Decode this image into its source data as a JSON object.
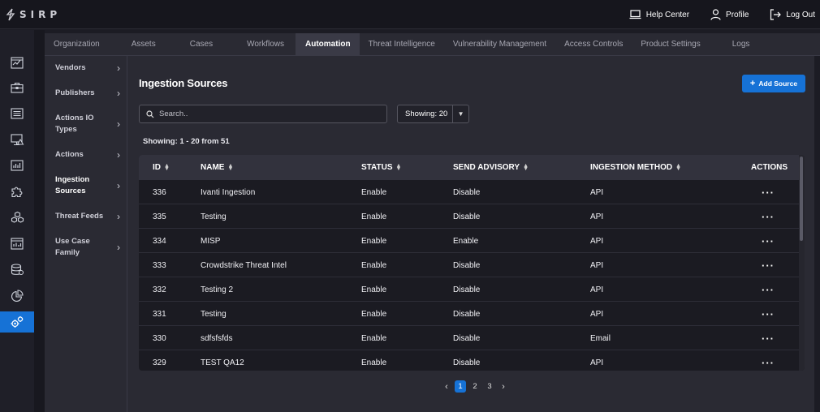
{
  "app": {
    "logo_text": "SIRP"
  },
  "topbar": {
    "help_center": "Help Center",
    "profile": "Profile",
    "logout": "Log Out"
  },
  "rail": {
    "items": [
      "dashboard-icon",
      "briefcase-icon",
      "list-icon",
      "monitor-alert-icon",
      "chart-icon",
      "puzzle-icon",
      "cubes-icon",
      "report-icon",
      "database-icon",
      "pie-chart-icon",
      "gears-icon"
    ],
    "active_index": 10
  },
  "tabs": [
    {
      "label": "Organization"
    },
    {
      "label": "Assets"
    },
    {
      "label": "Cases"
    },
    {
      "label": "Workflows"
    },
    {
      "label": "Automation",
      "active": true
    },
    {
      "label": "Threat Intelligence"
    },
    {
      "label": "Vulnerability Management"
    },
    {
      "label": "Access Controls"
    },
    {
      "label": "Product Settings"
    },
    {
      "label": "Logs"
    }
  ],
  "subnav": [
    {
      "label": "Vendors"
    },
    {
      "label": "Publishers"
    },
    {
      "label": "Actions IO Types"
    },
    {
      "label": "Actions"
    },
    {
      "label": "Ingestion Sources",
      "active": true
    },
    {
      "label": "Threat Feeds"
    },
    {
      "label": "Use Case Family"
    }
  ],
  "main": {
    "title": "Ingestion Sources",
    "add_button": "Add Source",
    "search_placeholder": "Search..",
    "showing_select": "Showing: 20",
    "count_text": "Showing: 1 - 20 from 51"
  },
  "table": {
    "columns": [
      "ID",
      "NAME",
      "STATUS",
      "SEND ADVISORY",
      "INGESTION METHOD",
      "ACTIONS"
    ],
    "rows": [
      {
        "id": "336",
        "name": "Ivanti Ingestion",
        "status": "Enable",
        "advisory": "Disable",
        "method": "API"
      },
      {
        "id": "335",
        "name": "Testing",
        "status": "Enable",
        "advisory": "Disable",
        "method": "API"
      },
      {
        "id": "334",
        "name": "MISP",
        "status": "Enable",
        "advisory": "Enable",
        "method": "API"
      },
      {
        "id": "333",
        "name": "Crowdstrike Threat Intel",
        "status": "Enable",
        "advisory": "Disable",
        "method": "API"
      },
      {
        "id": "332",
        "name": "Testing 2",
        "status": "Enable",
        "advisory": "Disable",
        "method": "API"
      },
      {
        "id": "331",
        "name": "Testing",
        "status": "Enable",
        "advisory": "Disable",
        "method": "API"
      },
      {
        "id": "330",
        "name": "sdfsfsfds",
        "status": "Enable",
        "advisory": "Disable",
        "method": "Email"
      },
      {
        "id": "329",
        "name": "TEST QA12",
        "status": "Enable",
        "advisory": "Disable",
        "method": "API"
      }
    ]
  },
  "pagination": {
    "pages": [
      "1",
      "2",
      "3"
    ],
    "current": "1"
  },
  "colors": {
    "accent": "#1672d6",
    "background": "#1c1c24",
    "panel": "#2a2a33"
  }
}
